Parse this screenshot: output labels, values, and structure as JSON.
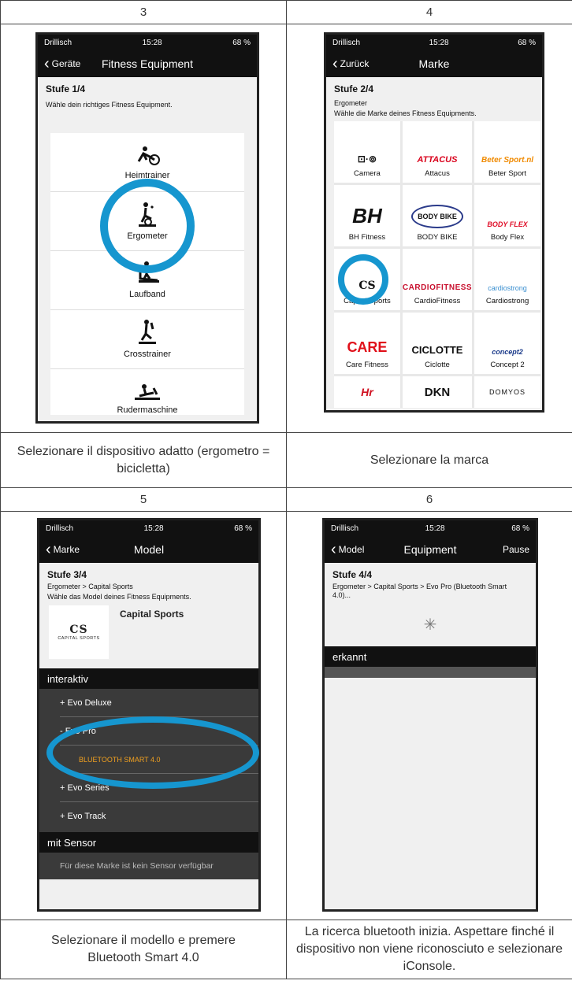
{
  "table": {
    "headers": [
      "3",
      "4",
      "5",
      "6"
    ],
    "captions": [
      "Selezionare il dispositivo adatto (ergometro = bicicletta)",
      "Selezionare la marca",
      "Selezionare il modello e premere Bluetooth Smart 4.0",
      "La ricerca bluetooth inizia. Aspettare finché il dispositivo non viene riconosciuto e selezionare iConsole."
    ]
  },
  "status": {
    "carrier": "Drillisch",
    "time": "15:28",
    "battery": "68 %"
  },
  "screen3": {
    "back": "Geräte",
    "title": "Fitness Equipment",
    "step": "Stufe 1/4",
    "subtitle": "Wähle dein richtiges Fitness Equipment.",
    "items": [
      {
        "label": "Heimtrainer",
        "icon": "bike-icon"
      },
      {
        "label": "Ergometer",
        "icon": "ergometer-icon"
      },
      {
        "label": "Laufband",
        "icon": "treadmill-icon"
      },
      {
        "label": "Crosstrainer",
        "icon": "crosstrainer-icon"
      },
      {
        "label": "Rudermaschine",
        "icon": "rower-icon"
      }
    ]
  },
  "screen4": {
    "back": "Zurück",
    "title": "Marke",
    "step": "Stufe 2/4",
    "subtitle1": "Ergometer",
    "subtitle2": "Wähle die Marke deines Fitness Equipments.",
    "brands": [
      {
        "name": "Camera",
        "logo": "⊡·⊚"
      },
      {
        "name": "Attacus",
        "logo": "ATTACUS"
      },
      {
        "name": "Beter Sport",
        "logo": "Beter Sport.nl"
      },
      {
        "name": "BH Fitness",
        "logo": "BH"
      },
      {
        "name": "BODY BIKE",
        "logo": "BODY BIKE"
      },
      {
        "name": "Body Flex",
        "logo": "BODY FLEX"
      },
      {
        "name": "Capital Sports",
        "logo": "CS"
      },
      {
        "name": "CardioFitness",
        "logo": "CARDIOFITNESS"
      },
      {
        "name": "Cardiostrong",
        "logo": "cardiostrong"
      },
      {
        "name": "Care Fitness",
        "logo": "CARE"
      },
      {
        "name": "Ciclotte",
        "logo": "CICLOTTE"
      },
      {
        "name": "Concept 2",
        "logo": "concept2"
      },
      {
        "name": "",
        "logo": "Hr"
      },
      {
        "name": "",
        "logo": "DKN"
      },
      {
        "name": "",
        "logo": "DOMYOS"
      }
    ]
  },
  "screen5": {
    "back": "Marke",
    "title": "Model",
    "step": "Stufe 3/4",
    "subtitle1": "Ergometer > Capital Sports",
    "subtitle2": "Wähle das Model deines Fitness Equipments.",
    "brand_name": "Capital Sports",
    "logo_cs": "CS",
    "logo_caption": "CAPITAL SPORTS",
    "section_interactive": "interaktiv",
    "models": [
      "+ Evo Deluxe",
      "- Evo Pro",
      "BLUETOOTH SMART 4.0",
      "+ Evo Series",
      "+ Evo Track"
    ],
    "section_sensor": "mit Sensor",
    "no_sensor": "Für diese Marke ist kein Sensor verfügbar"
  },
  "screen6": {
    "back": "Model",
    "title": "Equipment",
    "right": "Pause",
    "step": "Stufe 4/4",
    "subtitle": "Ergometer > Capital Sports > Evo Pro (Bluetooth Smart 4.0)...",
    "section": "erkannt"
  },
  "colors": {
    "ring": "#1696cf",
    "accent": "#f0a020"
  }
}
